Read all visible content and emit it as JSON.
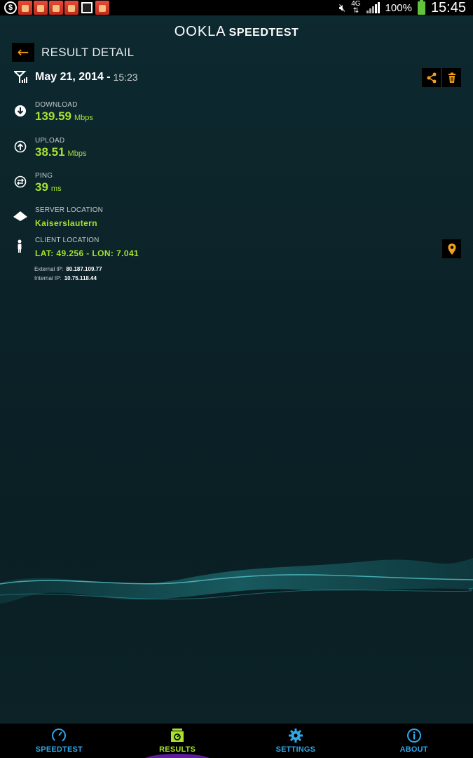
{
  "status_bar": {
    "network": "4G",
    "battery": "100%",
    "clock": "15:45"
  },
  "brand": {
    "logo_text": "OOKLA",
    "product": "SPEEDTEST"
  },
  "header": {
    "title": "RESULT DETAIL"
  },
  "result": {
    "date": "May 21, 2014 -",
    "time": "15:23",
    "download": {
      "label": "DOWNLOAD",
      "value": "139.59",
      "unit": "Mbps"
    },
    "upload": {
      "label": "UPLOAD",
      "value": "38.51",
      "unit": "Mbps"
    },
    "ping": {
      "label": "PING",
      "value": "39",
      "unit": "ms"
    },
    "server": {
      "label": "SERVER LOCATION",
      "value": "Kaiserslautern"
    },
    "client": {
      "label": "CLIENT LOCATION",
      "value": "LAT: 49.256 - LON: 7.041"
    },
    "external_ip": {
      "label": "External IP:",
      "value": "80.187.109.77"
    },
    "internal_ip": {
      "label": "Internal IP:",
      "value": "10.75.118.44"
    }
  },
  "nav": {
    "speedtest": "SPEEDTEST",
    "results": "RESULTS",
    "settings": "SETTINGS",
    "about": "ABOUT"
  },
  "colors": {
    "accent_green": "#a6e22e",
    "accent_orange": "#f3a21a",
    "accent_blue": "#2fa7e8"
  },
  "icons": [
    "back-arrow-icon",
    "antenna-icon",
    "share-icon",
    "trash-icon",
    "download-icon",
    "upload-icon",
    "ping-icon",
    "server-icon",
    "person-icon",
    "map-pin-icon",
    "gauge-icon",
    "results-icon",
    "gear-icon",
    "info-icon"
  ]
}
